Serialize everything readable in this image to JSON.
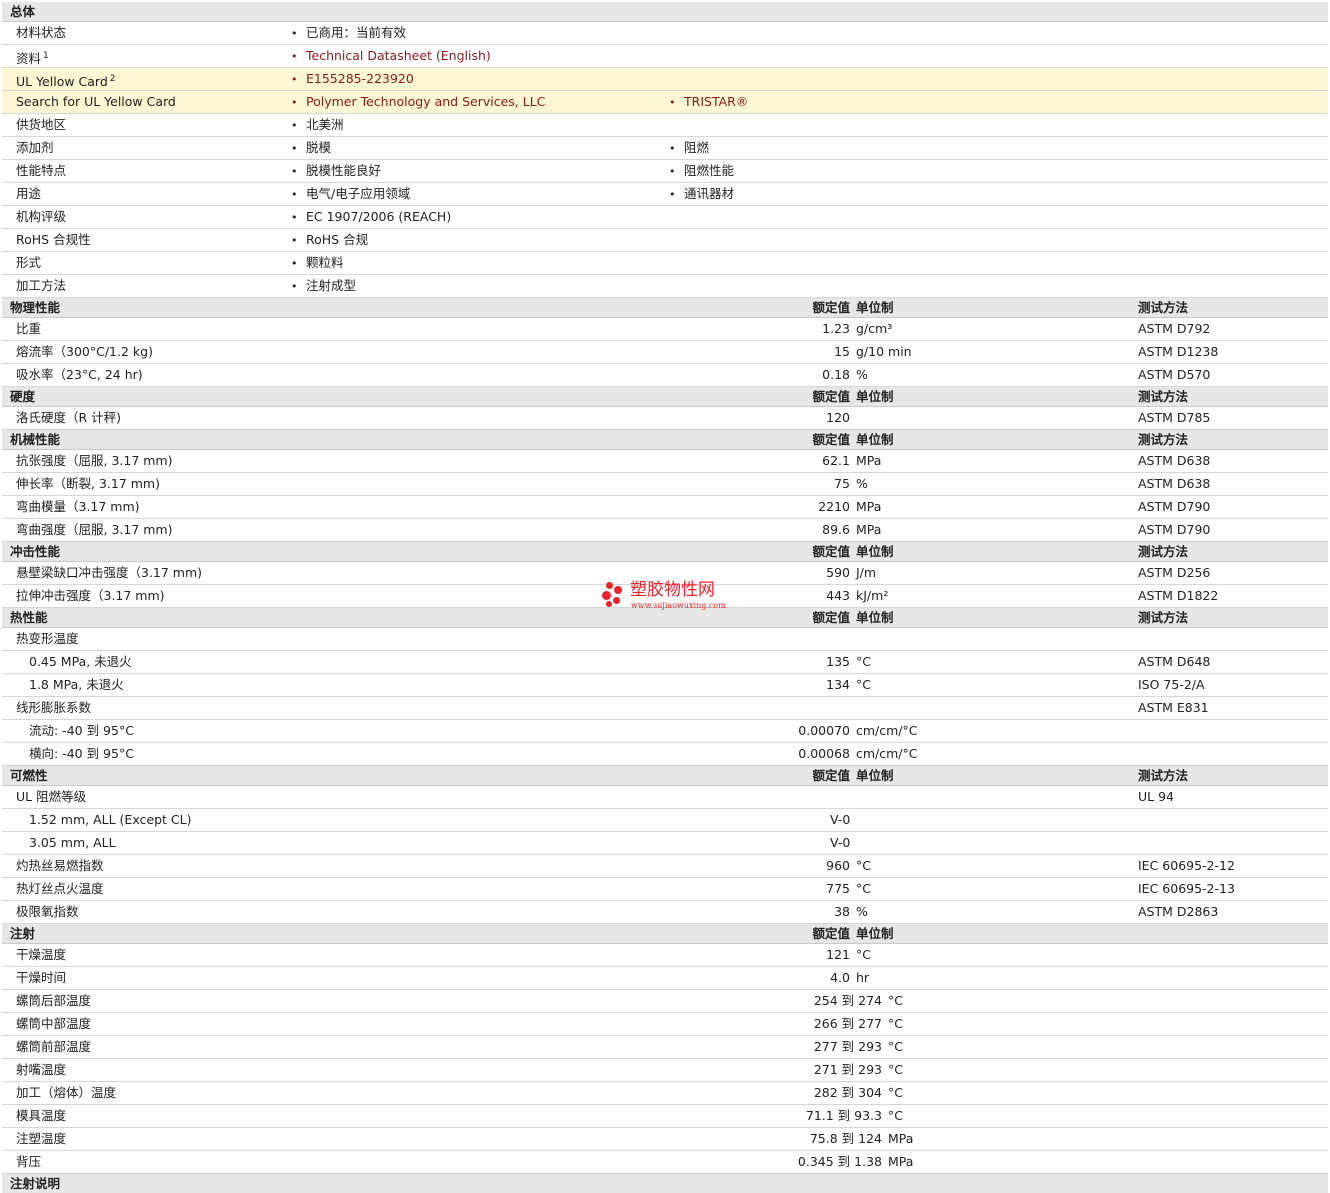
{
  "general": {
    "title": "总体",
    "rows": [
      {
        "label": "材料状态",
        "b1": "已商用：当前有效"
      },
      {
        "label": "资料",
        "sup": "1",
        "b1": "Technical Datasheet (English)",
        "link": true
      },
      {
        "label": "UL Yellow Card",
        "sup": "2",
        "b1": "E155285-223920",
        "link": true,
        "yellow": true
      },
      {
        "label": "Search for UL Yellow Card",
        "b1": "Polymer Technology and Services, LLC",
        "b2": "TRISTAR®",
        "link": true,
        "yellow": true
      },
      {
        "label": "供货地区",
        "b1": "北美洲"
      },
      {
        "label": "添加剂",
        "b1": "脱模",
        "b2": "阻燃"
      },
      {
        "label": "性能特点",
        "b1": "脱模性能良好",
        "b2": "阻燃性能"
      },
      {
        "label": "用途",
        "b1": "电气/电子应用领域",
        "b2": "通讯器材"
      },
      {
        "label": "机构评级",
        "b1": "EC 1907/2006 (REACH)"
      },
      {
        "label": "RoHS 合规性",
        "b1": "RoHS 合规"
      },
      {
        "label": "形式",
        "b1": "颗粒料"
      },
      {
        "label": "加工方法",
        "b1": "注射成型"
      }
    ]
  },
  "headers": {
    "value": "额定值",
    "unit": "单位制",
    "method": "测试方法"
  },
  "sections": [
    {
      "title": "物理性能",
      "method_header": true,
      "rows": [
        {
          "label": "比重",
          "value": "1.23",
          "unit": "g/cm³",
          "method": "ASTM D792"
        },
        {
          "label": "熔流率（300°C/1.2 kg)",
          "value": "15",
          "unit": "g/10 min",
          "method": "ASTM D1238"
        },
        {
          "label": "吸水率（23°C, 24 hr)",
          "value": "0.18",
          "unit": "%",
          "method": "ASTM D570"
        }
      ]
    },
    {
      "title": "硬度",
      "method_header": true,
      "rows": [
        {
          "label": "洛氏硬度（R 计秤)",
          "value": "120",
          "unit": "",
          "method": "ASTM D785"
        }
      ]
    },
    {
      "title": "机械性能",
      "method_header": true,
      "rows": [
        {
          "label": "抗张强度（屈服, 3.17 mm)",
          "value": "62.1",
          "unit": "MPa",
          "method": "ASTM D638"
        },
        {
          "label": "伸长率（断裂, 3.17 mm)",
          "value": "75",
          "unit": "%",
          "method": "ASTM D638"
        },
        {
          "label": "弯曲模量（3.17 mm)",
          "value": "2210",
          "unit": "MPa",
          "method": "ASTM D790"
        },
        {
          "label": "弯曲强度（屈服, 3.17 mm)",
          "value": "89.6",
          "unit": "MPa",
          "method": "ASTM D790"
        }
      ]
    },
    {
      "title": "冲击性能",
      "method_header": true,
      "rows": [
        {
          "label": "悬壁梁缺口冲击强度（3.17 mm)",
          "value": "590",
          "unit": "J/m",
          "method": "ASTM D256"
        },
        {
          "label": "拉伸冲击强度（3.17 mm)",
          "value": "443",
          "unit": "kJ/m²",
          "method": "ASTM D1822"
        }
      ]
    },
    {
      "title": "热性能",
      "method_header": true,
      "rows": [
        {
          "label": "热变形温度",
          "value": "",
          "unit": "",
          "method": ""
        },
        {
          "label": "0.45 MPa, 未退火",
          "indent": true,
          "value": "135",
          "unit": "°C",
          "method": "ASTM D648"
        },
        {
          "label": "1.8 MPa, 未退火",
          "indent": true,
          "value": "134",
          "unit": "°C",
          "method": "ISO 75-2/A"
        },
        {
          "label": "线形膨胀系数",
          "value": "",
          "unit": "",
          "method": "ASTM E831"
        },
        {
          "label": "流动: -40 到  95°C",
          "indent": true,
          "value": "0.00070",
          "unit": "cm/cm/°C",
          "method": ""
        },
        {
          "label": "横向: -40 到  95°C",
          "indent": true,
          "value": "0.00068",
          "unit": "cm/cm/°C",
          "method": ""
        }
      ]
    },
    {
      "title": "可燃性",
      "method_header": true,
      "rows": [
        {
          "label": "UL 阻燃等级",
          "value": "",
          "unit": "",
          "method": "UL 94"
        },
        {
          "label": "1.52 mm, ALL (Except CL)",
          "indent": true,
          "value": "V-0",
          "unit": "",
          "method": "",
          "left_value": true
        },
        {
          "label": "3.05 mm, ALL",
          "indent": true,
          "value": "V-0",
          "unit": "",
          "method": "",
          "left_value": true
        },
        {
          "label": "灼热丝易燃指数",
          "value": "960",
          "unit": "°C",
          "method": "IEC 60695-2-12"
        },
        {
          "label": "热灯丝点火温度",
          "value": "775",
          "unit": "°C",
          "method": "IEC 60695-2-13"
        },
        {
          "label": "极限氧指数",
          "value": "38",
          "unit": "%",
          "method": "ASTM D2863"
        }
      ]
    },
    {
      "title": "注射",
      "method_header": false,
      "rows": [
        {
          "label": "干燥温度",
          "value": "121",
          "unit": "°C",
          "method": ""
        },
        {
          "label": "干燥时间",
          "value": "4.0",
          "unit": "hr",
          "method": ""
        },
        {
          "label": "螺筒后部温度",
          "value": "254 到  274",
          "unit": "°C",
          "method": "",
          "range": true
        },
        {
          "label": "螺筒中部温度",
          "value": "266 到  277",
          "unit": "°C",
          "method": "",
          "range": true
        },
        {
          "label": "螺筒前部温度",
          "value": "277 到  293",
          "unit": "°C",
          "method": "",
          "range": true
        },
        {
          "label": "射嘴温度",
          "value": "271 到  293",
          "unit": "°C",
          "method": "",
          "range": true
        },
        {
          "label": "加工（熔体）温度",
          "value": "282 到  304",
          "unit": "°C",
          "method": "",
          "range": true
        },
        {
          "label": "模具温度",
          "value": "71.1 到  93.3",
          "unit": "°C",
          "method": "",
          "range": true
        },
        {
          "label": "注塑温度",
          "value": "75.8 到  124",
          "unit": "MPa",
          "method": "",
          "range": true
        },
        {
          "label": "背压",
          "value": "0.345 到  1.38",
          "unit": "MPa",
          "method": "",
          "range": true
        }
      ]
    },
    {
      "title": "注射说明",
      "no_headers": true,
      "rows": []
    }
  ],
  "watermark": {
    "name": "塑胶物性网",
    "url": "www.sujiaowuxing.com",
    "color": "#e8232a"
  }
}
